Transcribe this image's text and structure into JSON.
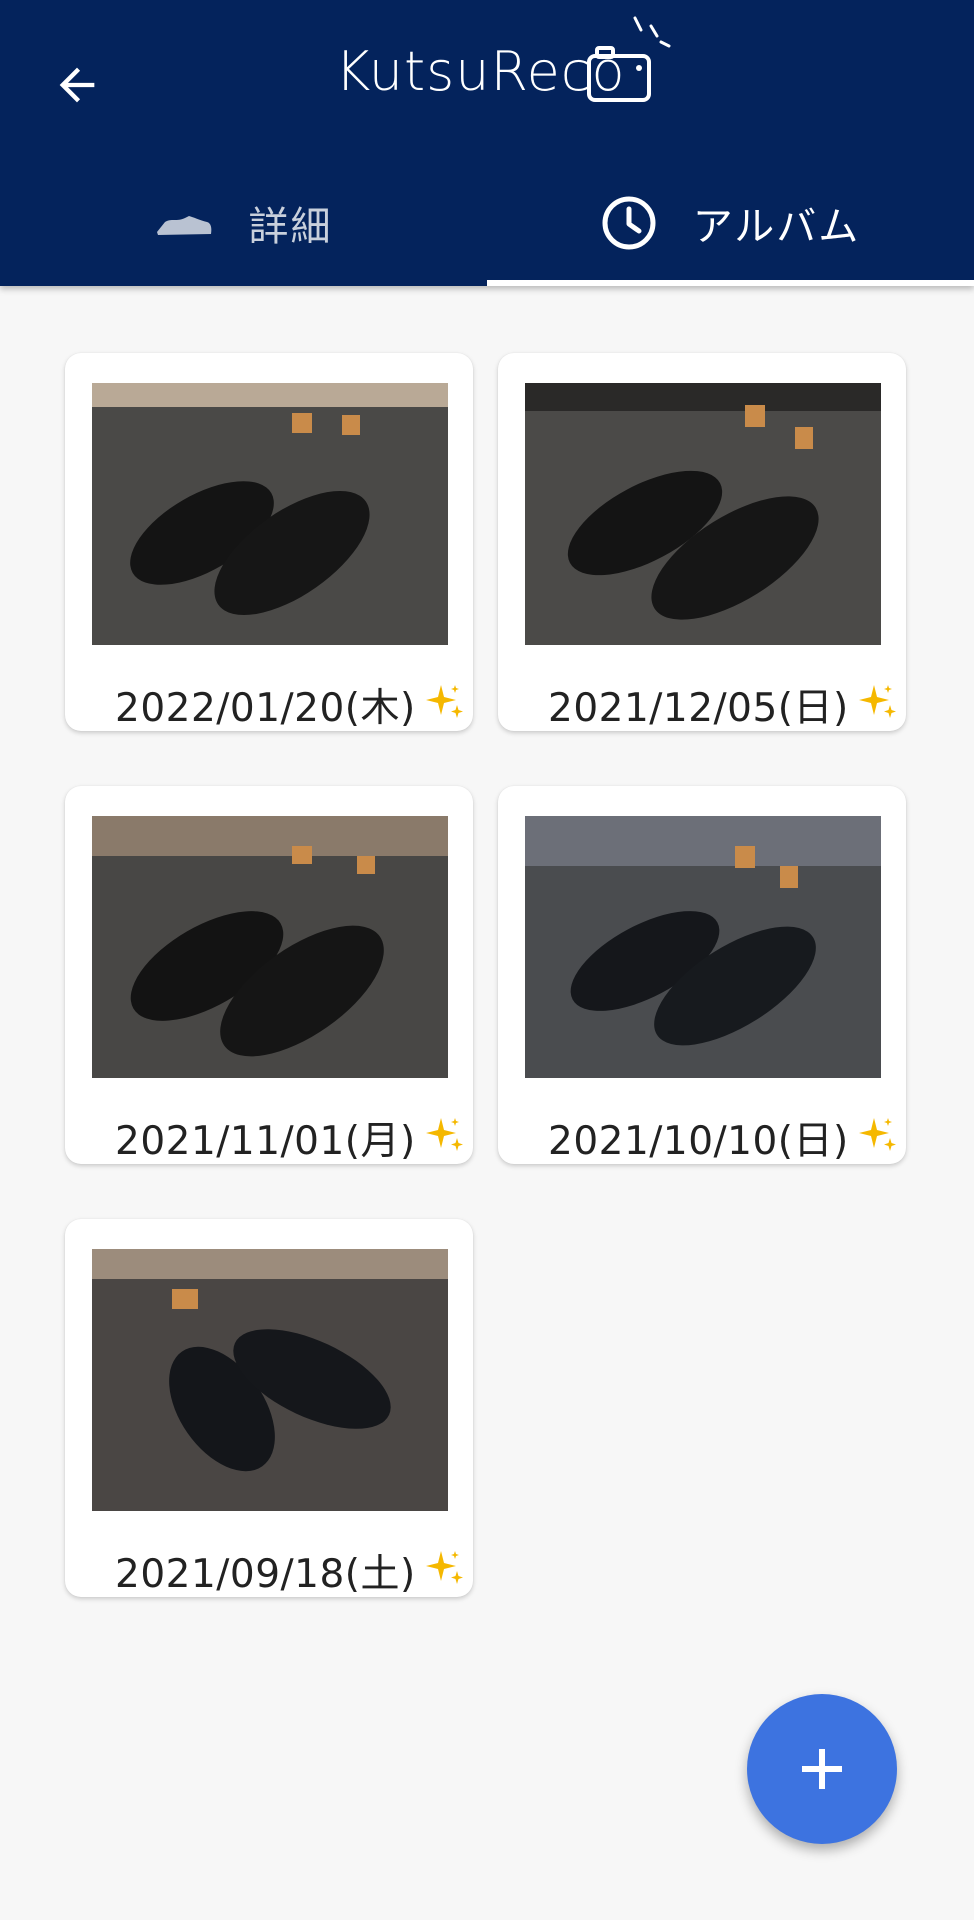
{
  "app": {
    "logo_text": "KutsuReco"
  },
  "tabs": [
    {
      "label": "詳細",
      "icon": "shoe-icon",
      "active": false
    },
    {
      "label": "アルバム",
      "icon": "clock-icon",
      "active": true
    }
  ],
  "album": [
    {
      "date": "2022/01/20(木)",
      "photo": "black-double-monk-shoes-photo",
      "badge_icon": "sparkle-icon"
    },
    {
      "date": "2021/12/05(日)",
      "photo": "black-double-monk-shoes-photo",
      "badge_icon": "sparkle-icon"
    },
    {
      "date": "2021/11/01(月)",
      "photo": "black-double-monk-shoes-photo",
      "badge_icon": "sparkle-icon"
    },
    {
      "date": "2021/10/10(日)",
      "photo": "black-double-monk-shoes-photo",
      "badge_icon": "sparkle-icon"
    },
    {
      "date": "2021/09/18(土)",
      "photo": "black-double-monk-shoes-photo",
      "badge_icon": "sparkle-icon"
    }
  ],
  "colors": {
    "appbar": "#04235c",
    "background": "#f7f7f7",
    "fab": "#3d73e0",
    "sparkle": "#f5b800"
  }
}
